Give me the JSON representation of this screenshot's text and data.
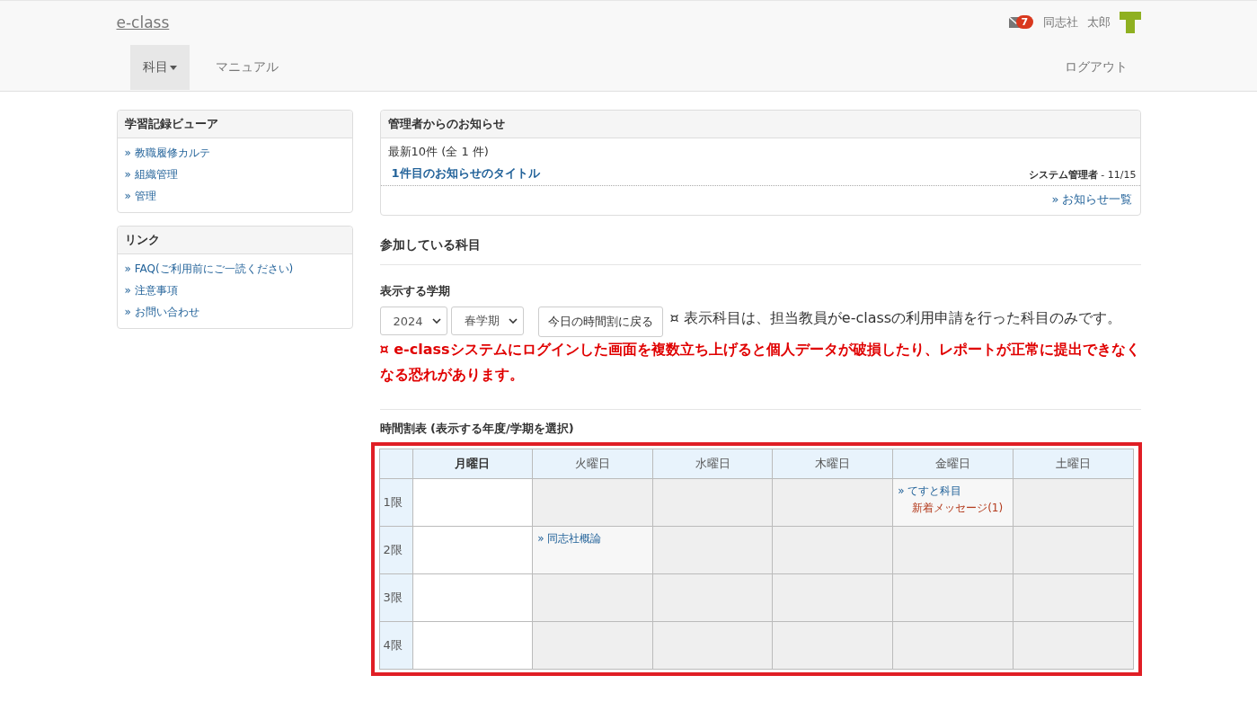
{
  "brand": "e-class",
  "user": {
    "unread": "7",
    "org": "同志社",
    "name": "太郎"
  },
  "nav": [
    {
      "label": "科目",
      "dropdown": true,
      "selected": true
    },
    {
      "label": "マニュアル",
      "dropdown": false,
      "selected": false
    }
  ],
  "logout": "ログアウト",
  "sidebar": [
    {
      "title": "学習記録ビューア",
      "links": [
        "» 教職履修カルテ",
        "» 組織管理",
        "» 管理"
      ]
    },
    {
      "title": "リンク",
      "links": [
        "» FAQ(ご利用前にご一読ください)",
        "» 注意事項",
        "» お問い合わせ"
      ]
    }
  ],
  "notice": {
    "title": "管理者からのお知らせ",
    "count": "最新10件 (全 1 件)",
    "items": [
      {
        "title": "1件目のお知らせのタイトル",
        "author": "システム管理者",
        "date": " - 11/15"
      }
    ],
    "more": "» お知らせ一覧"
  },
  "courses_heading": "参加している科目",
  "term": {
    "label": "表示する学期",
    "year": "2024",
    "semester": "春学期",
    "today_button": "今日の時間割に戻る",
    "note": "¤ 表示科目は、担当教員がe-classの利用申請を行った科目のみです。",
    "warning": "¤ e-classシステムにログインした画面を複数立ち上げると個人データが破損したり、レポートが正常に提出できなくなる恐れがあります。"
  },
  "timetable": {
    "title": "時間割表 (表示する年度/学期を選択)",
    "days": [
      {
        "label": "月曜日",
        "selected": true
      },
      {
        "label": "火曜日",
        "selected": false
      },
      {
        "label": "水曜日",
        "selected": false
      },
      {
        "label": "木曜日",
        "selected": false
      },
      {
        "label": "金曜日",
        "selected": false
      },
      {
        "label": "土曜日",
        "selected": false
      }
    ],
    "rows": [
      {
        "period": "1限",
        "cells": [
          {},
          {},
          {},
          {},
          {
            "course": "» てすと科目",
            "message": "新着メッセージ(1)"
          },
          {}
        ]
      },
      {
        "period": "2限",
        "cells": [
          {},
          {
            "course": "» 同志社概論"
          },
          {},
          {},
          {},
          {}
        ]
      },
      {
        "period": "3限",
        "cells": [
          {},
          {},
          {},
          {},
          {},
          {}
        ]
      },
      {
        "period": "4限",
        "cells": [
          {},
          {},
          {},
          {},
          {},
          {}
        ]
      }
    ]
  }
}
